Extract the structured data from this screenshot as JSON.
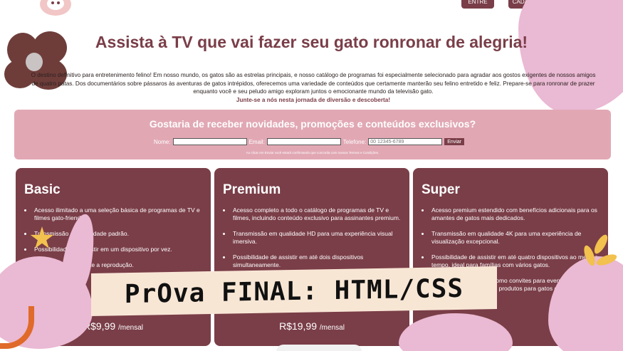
{
  "header": {
    "login_label": "ENTRE",
    "signup_label": "CADASTRO"
  },
  "hero": {
    "title": "Assista à TV que vai fazer seu gato ronronar de alegria!",
    "intro": "O destino definitivo para entretenimento felino! Em nosso mundo, os gatos são as estrelas principais, e nosso catálogo de programas foi especialmente selecionado para agradar aos gostos exigentes de nossos amigos de quatro patas. Dos documentários sobre pássaros às aventuras de gatos intrépidos, oferecemos uma variedade de conteúdos que certamente manterão seu felino entretido e feliz. Prepare-se para ronronar de prazer enquanto você e seu peludo amigo exploram juntos o emocionante mundo da televisão gato.",
    "cta": "Junte-se a nós nesta jornada de diversão e descoberta!"
  },
  "newsletter": {
    "title": "Gostaria de receber novidades, promoções e conteúdos exclusivos?",
    "name_label": "Nome:",
    "email_label": "Email:",
    "phone_label": "Telefone:",
    "phone_placeholder": "00 12345-6789",
    "send_label": "Enviar",
    "disclaimer": "Ao clicar em Enviar você estará confirmando que concorda com nossos Termos e Condições."
  },
  "plans": [
    {
      "name": "Basic",
      "features": [
        "Acesso ilimitado a uma seleção básica de programas de TV e filmes gato-friendly.",
        "Transmissão em qualidade padrão.",
        "Possibilidade de assistir em um dispositivo por vez.",
        "Sem anúncios durante a reprodução."
      ],
      "price": "R$9,99",
      "period": "/mensal"
    },
    {
      "name": "Premium",
      "features": [
        "Acesso completo a todo o catálogo de programas de TV e filmes, incluindo conteúdo exclusivo para assinantes premium.",
        "Transmissão em qualidade HD para uma experiência visual imersiva.",
        "Possibilidade de assistir em até dois dispositivos simultaneamente."
      ],
      "price": "R$19,99",
      "period": "/mensal"
    },
    {
      "name": "Super",
      "features": [
        "Acesso premium estendido com benefícios adicionais para os amantes de gatos mais dedicados.",
        "Transmissão em qualidade 4K para uma experiência de visualização excepcional.",
        "Possibilidade de assistir em até quatro dispositivos ao mesmo tempo, ideal para famílias com vários gatos.",
        "Benefícios exclusivos, como convites para eventos especiais, sorteios e descontos em produtos para gatos de marcas e em parceiros selecionados."
      ],
      "price": "",
      "period": ""
    }
  ],
  "overlay": {
    "banner_text": "PrOva FINAL: HTML/CSS"
  }
}
